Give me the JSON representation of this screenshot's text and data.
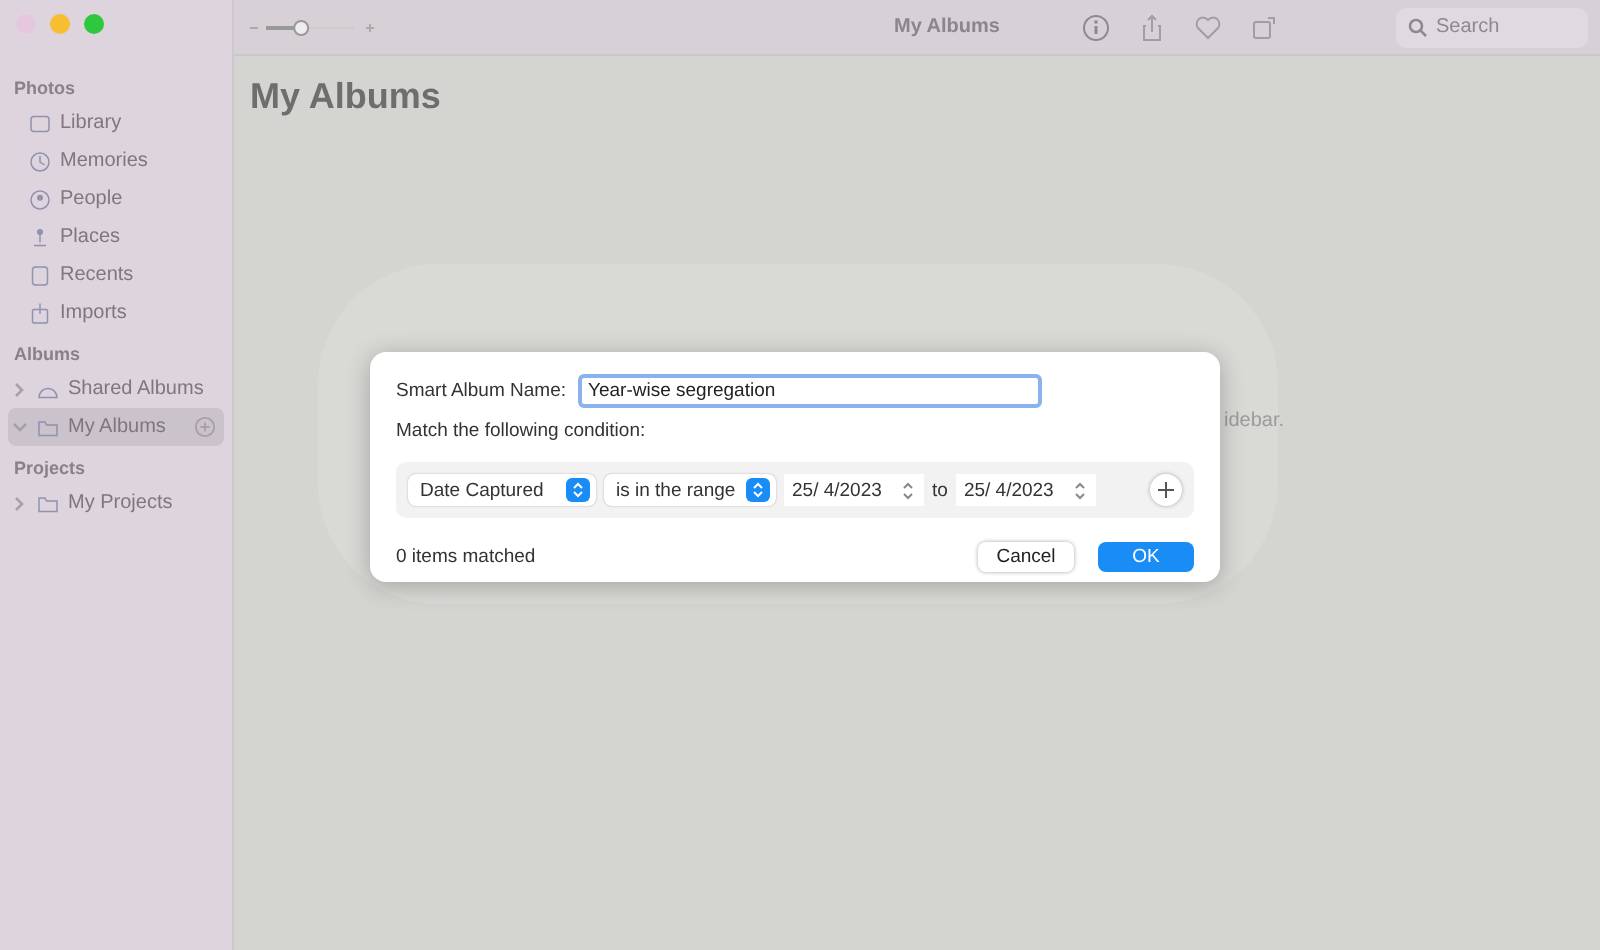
{
  "window": {
    "title": "My Albums"
  },
  "toolbar": {
    "search": {
      "placeholder": "Search"
    },
    "zoom": {
      "level": 0.4
    }
  },
  "sidebar": {
    "sections": [
      {
        "title": "Photos",
        "items": [
          {
            "label": "Library",
            "selected": false
          },
          {
            "label": "Memories",
            "selected": false
          },
          {
            "label": "People",
            "selected": false
          },
          {
            "label": "Places",
            "selected": false
          },
          {
            "label": "Recents",
            "selected": false
          },
          {
            "label": "Imports",
            "selected": false
          }
        ]
      },
      {
        "title": "Albums",
        "items": [
          {
            "label": "Shared Albums",
            "selected": false,
            "expanded": false
          },
          {
            "label": "My Albums",
            "selected": true,
            "expanded": true
          }
        ]
      },
      {
        "title": "Projects",
        "items": [
          {
            "label": "My Projects",
            "selected": false,
            "expanded": false
          }
        ]
      }
    ]
  },
  "main": {
    "heading": "My Albums",
    "background_text": "idebar."
  },
  "dialog": {
    "name_label": "Smart Album Name:",
    "name_value": "Year-wise segregation",
    "condition_label": "Match the following condition:",
    "condition": {
      "field": "Date Captured",
      "operator": "is in the range",
      "from": "25/  4/2023",
      "joiner": "to",
      "to": "25/  4/2023"
    },
    "status": "0 items matched",
    "buttons": [
      {
        "label": "Cancel",
        "kind": "secondary"
      },
      {
        "label": "OK",
        "kind": "primary"
      }
    ]
  }
}
